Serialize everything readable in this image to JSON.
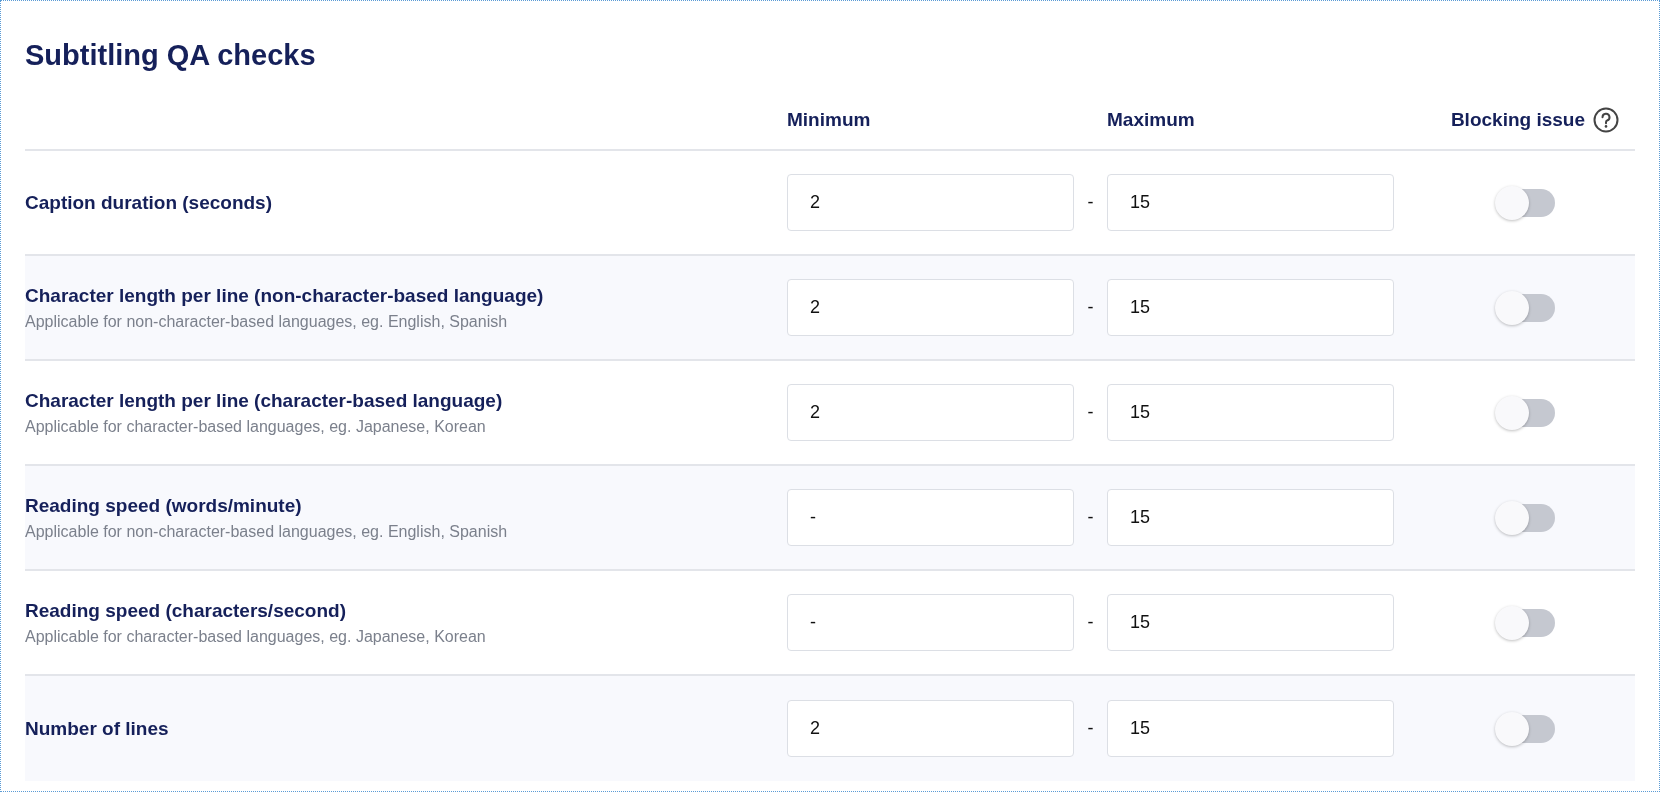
{
  "title": "Subtitling QA checks",
  "columns": {
    "minimum": "Minimum",
    "maximum": "Maximum",
    "blocking": "Blocking issue"
  },
  "rows": [
    {
      "label": "Caption duration (seconds)",
      "minimum": "2",
      "separator": "-",
      "maximum": "15",
      "blocking": false
    },
    {
      "label": "Character length per line (non-character-based language)",
      "hint": "Applicable for non-character-based languages, eg. English, Spanish",
      "minimum": "2",
      "separator": "-",
      "maximum": "15",
      "blocking": false
    },
    {
      "label": "Character length per line (character-based language)",
      "hint": "Applicable for character-based languages, eg. Japanese, Korean",
      "minimum": "2",
      "separator": "-",
      "maximum": "15",
      "blocking": false
    },
    {
      "label": "Reading speed (words/minute)",
      "hint": "Applicable for non-character-based languages, eg. English, Spanish",
      "minimum": "-",
      "separator": "-",
      "maximum": "15",
      "blocking": false
    },
    {
      "label": "Reading speed (characters/second)",
      "hint": "Applicable for character-based languages, eg. Japanese, Korean",
      "minimum": "-",
      "separator": "-",
      "maximum": "15",
      "blocking": false
    },
    {
      "label": "Number of lines",
      "minimum": "2",
      "separator": "-",
      "maximum": "15",
      "blocking": false
    }
  ]
}
